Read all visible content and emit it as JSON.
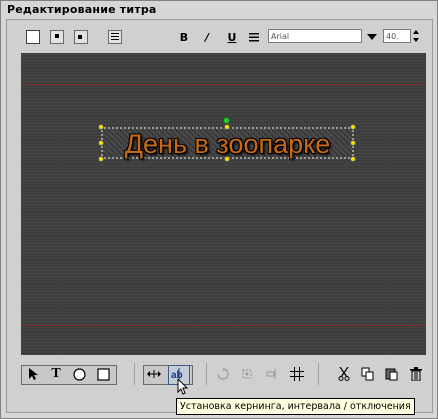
{
  "window": {
    "title": "Редактирование титра"
  },
  "toolbar": {
    "bold_label": "B",
    "italic_label": "/",
    "underline_label": "U",
    "font_name": "Arial",
    "font_size": "40."
  },
  "canvas": {
    "title_text": "День в зоопарке"
  },
  "bottom_toolbar": {
    "text_tool_label": "T"
  },
  "tooltip": {
    "text": "Установка кернинга, интервала / отключения"
  }
}
